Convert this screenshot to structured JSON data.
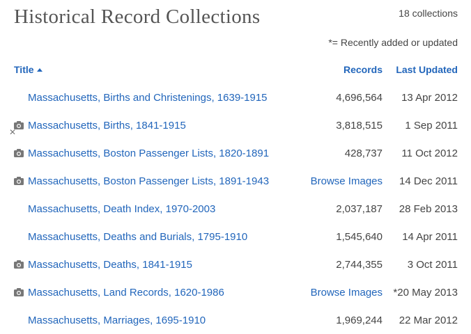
{
  "page": {
    "title": "Historical Record Collections",
    "count": "18 collections",
    "legend": "*= Recently added or updated"
  },
  "table": {
    "headers": {
      "title": "Title",
      "records": "Records",
      "last_updated": "Last Updated"
    },
    "rows": [
      {
        "title": "Massachusetts, Births and Christenings, 1639-1915",
        "records": "4,696,564",
        "updated": "13 Apr 2012",
        "has_images": false,
        "records_link": false
      },
      {
        "title": "Massachusetts, Births, 1841-1915",
        "records": "3,818,515",
        "updated": "1 Sep 2011",
        "has_images": true,
        "records_link": false
      },
      {
        "title": "Massachusetts, Boston Passenger Lists, 1820-1891",
        "records": "428,737",
        "updated": "11 Oct 2012",
        "has_images": true,
        "records_link": false
      },
      {
        "title": "Massachusetts, Boston Passenger Lists, 1891-1943",
        "records": "Browse Images",
        "updated": "14 Dec 2011",
        "has_images": true,
        "records_link": true
      },
      {
        "title": "Massachusetts, Death Index, 1970-2003",
        "records": "2,037,187",
        "updated": "28 Feb 2013",
        "has_images": false,
        "records_link": false
      },
      {
        "title": "Massachusetts, Deaths and Burials, 1795-1910",
        "records": "1,545,640",
        "updated": "14 Apr 2011",
        "has_images": false,
        "records_link": false
      },
      {
        "title": "Massachusetts, Deaths, 1841-1915",
        "records": "2,744,355",
        "updated": "3 Oct 2011",
        "has_images": true,
        "records_link": false
      },
      {
        "title": "Massachusetts, Land Records, 1620-1986",
        "records": "Browse Images",
        "updated": "*20 May 2013",
        "has_images": true,
        "records_link": true
      },
      {
        "title": "Massachusetts, Marriages, 1695-1910",
        "records": "1,969,244",
        "updated": "22 Mar 2012",
        "has_images": false,
        "records_link": false
      }
    ]
  },
  "icons": {
    "camera": "camera-icon",
    "close": "close-icon"
  },
  "colors": {
    "link": "#2266bb",
    "text": "#444444",
    "title": "#555555"
  }
}
